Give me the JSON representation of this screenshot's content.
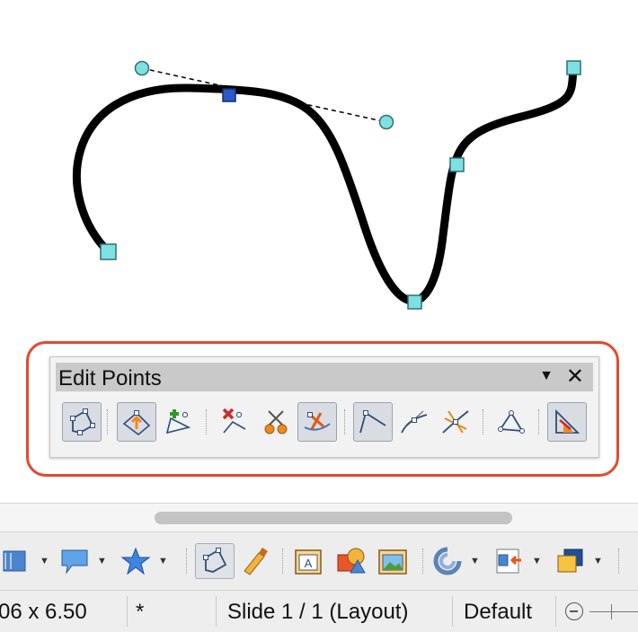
{
  "edit_points_toolbar": {
    "title": "Edit Points",
    "menu_glyph": "▼",
    "close_glyph": "✕",
    "buttons": [
      {
        "name": "points-icon",
        "active": true
      },
      {
        "name": "move-points-icon",
        "active": true
      },
      {
        "name": "insert-points-icon",
        "active": false
      },
      {
        "name": "delete-points-icon",
        "active": false
      },
      {
        "name": "split-curve-icon",
        "active": false
      },
      {
        "name": "convert-to-curve-icon",
        "active": true
      },
      {
        "name": "corner-point-icon",
        "active": true
      },
      {
        "name": "smooth-transition-icon",
        "active": false
      },
      {
        "name": "symmetric-transition-icon",
        "active": false
      },
      {
        "name": "close-bezier-icon",
        "active": false
      },
      {
        "name": "eliminate-points-icon",
        "active": true
      }
    ]
  },
  "drawing_toolbar": {
    "items": [
      "block-arrows-icon",
      "callouts-icon",
      "stars-icon",
      "points-icon",
      "glue-points-icon",
      "fontwork-gallery-icon",
      "from-file-icon",
      "image-icon",
      "rotate-icon",
      "alignment-icon",
      "arrange-icon"
    ]
  },
  "status_bar": {
    "size": "06 x 6.50",
    "modified": "*",
    "slide": "Slide 1 / 1 (Layout)",
    "master": "Default"
  },
  "colors": {
    "highlight": "#e4492d",
    "handle_fill": "#7fe0e0",
    "selected_handle": "#2b57c7"
  }
}
